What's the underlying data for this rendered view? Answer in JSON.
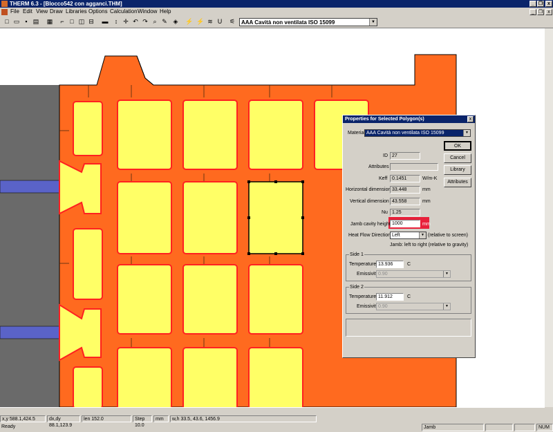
{
  "app": {
    "title": "THERM 6.3 - [Blocco542 con agganci.THM]"
  },
  "window_controls": {
    "minimize": "_",
    "restore": "❐",
    "close": "x"
  },
  "menu": [
    "File",
    "Edit",
    "View",
    "Draw",
    "Libraries",
    "Options",
    "Calculation",
    "Window",
    "Help"
  ],
  "toolbar": {
    "tools": [
      "new-icon",
      "open-icon",
      "save-icon",
      "print-icon",
      "properties-icon",
      "polygon-icon",
      "rectangle-icon",
      "fill-void-icon",
      "boundary-icon",
      "locator-icon",
      "move-icon",
      "pan-icon",
      "undo-icon",
      "redo-icon",
      "zoom-icon",
      "edit-points-icon",
      "calculate-icon",
      "results-icon",
      "u-factor-icon",
      "boundary-condition-icon"
    ],
    "material_combo": "AAA Cavità non ventilata ISO 15099"
  },
  "colors": {
    "orange": "#ff6a1f",
    "yellow": "#ffff66",
    "grey": "#6a6a6a",
    "blue": "#5a63c8",
    "red_outline": "#ff2020",
    "highlight": "#e8203a"
  },
  "dialog": {
    "title": "Properties for Selected Polygon(s)",
    "material_label": "Material",
    "material_value": "AAA Cavità non ventilata ISO 15099",
    "id_label": "ID",
    "id_value": "27",
    "attributes_label": "Attributes",
    "attributes_value": "",
    "keff_label": "Keff",
    "keff_value": "0.1451",
    "keff_unit": "W/m-K",
    "hdim_label": "Horizontal dimension",
    "hdim_value": "33.448",
    "hdim_unit": "mm",
    "vdim_label": "Vertical dimension",
    "vdim_value": "43.558",
    "vdim_unit": "mm",
    "nu_label": "Nu",
    "nu_value": "1.25",
    "jamb_label": "Jamb cavity height",
    "jamb_value": "1000",
    "jamb_unit": "mm",
    "hfd_label": "Heat Flow Direction",
    "hfd_value": "Left",
    "hfd_note": "(relative to screen)",
    "jamb_note": "Jamb: left to right (relative to gravity)",
    "side1": {
      "title": "Side 1",
      "temp_label": "Temperature",
      "temp_value": "13.936",
      "temp_unit": "C",
      "emis_label": "Emissivity",
      "emis_value": "0.90"
    },
    "side2": {
      "title": "Side 2",
      "temp_label": "Temperature",
      "temp_value": "11.912",
      "temp_unit": "C",
      "emis_label": "Emissivity",
      "emis_value": "0.90"
    },
    "buttons": {
      "ok": "OK",
      "cancel": "Cancel",
      "library": "Library",
      "attributes": "Attributes"
    },
    "close": "x"
  },
  "coords": {
    "xy": "x,y 588.1,424.5",
    "dxdy": "dx,dy 88.1,123.9",
    "len": "len 152.0",
    "step": "Step 10.0",
    "unit": "mm",
    "wh": "w,h 33.5, 43.6, 1456.9"
  },
  "status": {
    "ready": "Ready",
    "mode": "Jamb",
    "num": "NUM"
  }
}
